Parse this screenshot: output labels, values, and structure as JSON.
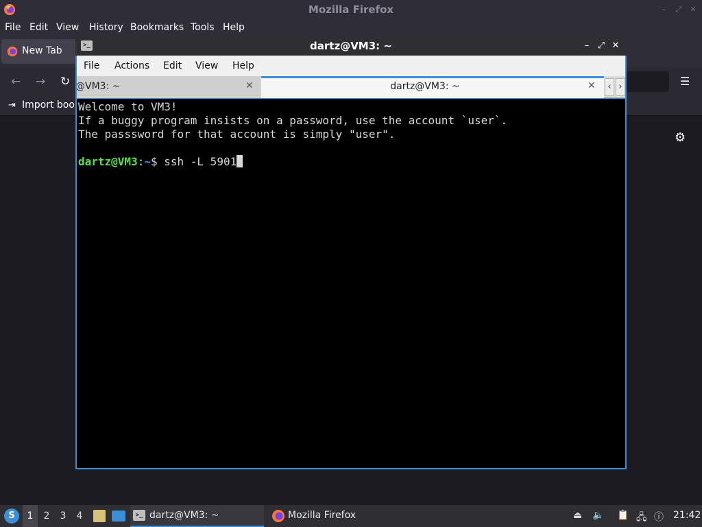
{
  "firefox": {
    "title": "Mozilla Firefox",
    "menu": [
      "File",
      "Edit",
      "View",
      "History",
      "Bookmarks",
      "Tools",
      "Help"
    ],
    "tab_label": "New Tab",
    "import_bookmarks": "Import book"
  },
  "terminal": {
    "title": "dartz@VM3: ~",
    "menu": [
      "File",
      "Actions",
      "Edit",
      "View",
      "Help"
    ],
    "tabs": [
      {
        "label": "@VM3: ~",
        "active": false
      },
      {
        "label": "dartz@VM3: ~",
        "active": true
      }
    ],
    "lines": [
      "Welcome to VM3!",
      "If a buggy program insists on a password, use the account `user`.",
      "The passsword for that account is simply \"user\"."
    ],
    "prompt_user": "dartz@VM3",
    "prompt_sep": ":",
    "prompt_path": "~",
    "prompt_symbol": "$ ",
    "command": "ssh -L 5901"
  },
  "taskbar": {
    "workspaces": [
      "1",
      "2",
      "3",
      "4"
    ],
    "active_workspace": "1",
    "tasks": [
      {
        "label": "dartz@VM3: ~",
        "active": true
      },
      {
        "label": "Mozilla Firefox",
        "active": false
      }
    ],
    "clock": "21:42"
  },
  "colors": {
    "accent": "#3a8fd8",
    "prompt_user": "#55e04a",
    "prompt_path": "#4a8cff"
  }
}
